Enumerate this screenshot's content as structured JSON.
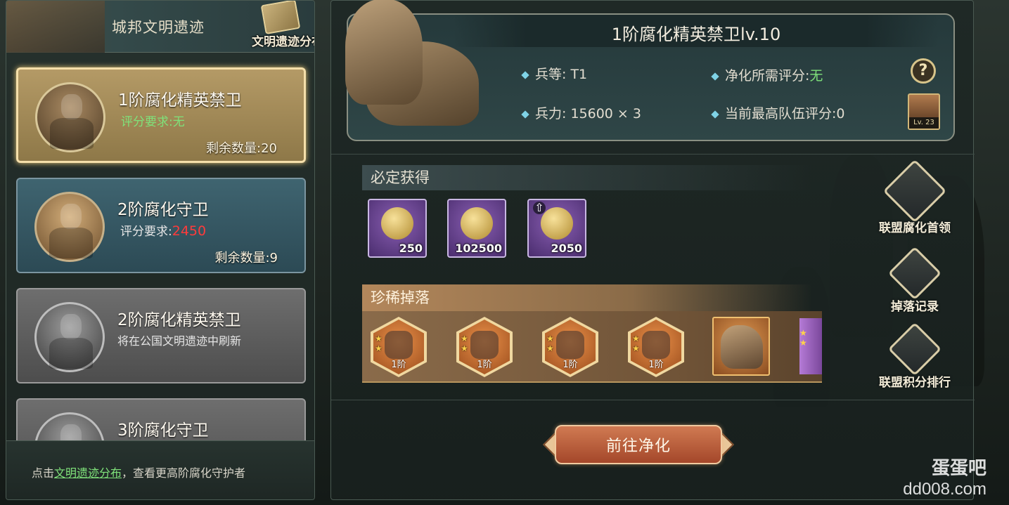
{
  "left": {
    "title": "城邦文明遗迹",
    "map_button_label": "文明遗迹分布",
    "cards": [
      {
        "name": "1阶腐化精英禁卫",
        "req_label": "评分要求:",
        "req_value": "无",
        "remaining": "剩余数量:20"
      },
      {
        "name": "2阶腐化守卫",
        "req_label": "评分要求:",
        "req_value": "2450",
        "remaining": "剩余数量:9"
      },
      {
        "name": "2阶腐化精英禁卫",
        "note": "将在公国文明遗迹中刷新"
      },
      {
        "name": "3阶腐化守卫"
      }
    ],
    "footer": {
      "prefix": "点击",
      "link": "文明遗迹分布",
      "suffix": "，查看更高阶腐化守护者"
    }
  },
  "detail": {
    "title": "1阶腐化精英禁卫lv.10",
    "troop_tier_label": "兵等:",
    "troop_tier_value": "T1",
    "purify_score_label": "净化所需评分:",
    "purify_score_value": "无",
    "troops_label": "兵力:",
    "troops_value": "15600 × 3",
    "best_team_label": "当前最高队伍评分:",
    "best_team_value": "0",
    "help_icon": "?",
    "avatar_level": "Lv. 23"
  },
  "rewards": {
    "guaranteed_title": "必定获得",
    "guaranteed": [
      {
        "icon": "medal-icon",
        "count": "250"
      },
      {
        "icon": "gold-coins-icon",
        "count": "102500"
      },
      {
        "icon": "gold-coins-upgrade-icon",
        "count": "2050"
      }
    ],
    "rare_title": "珍稀掉落",
    "rare": [
      {
        "icon": "shield-gear-icon",
        "tier": "1阶",
        "stars": 2
      },
      {
        "icon": "hero-portrait-icon",
        "tier": "1阶",
        "stars": 2
      },
      {
        "icon": "book-chest-icon",
        "tier": "1阶",
        "stars": 2
      },
      {
        "icon": "horn-icon",
        "tier": "1阶",
        "stars": 2
      }
    ]
  },
  "go_button_label": "前往净化",
  "side_buttons": [
    {
      "icon": "alliance-boss-icon",
      "label": "联盟腐化首领"
    },
    {
      "icon": "coins-drop-icon",
      "label": "掉落记录"
    },
    {
      "icon": "medal-rank-icon",
      "label": "联盟积分排行"
    }
  ],
  "watermark": {
    "top": "蛋蛋吧",
    "bottom": "dd008.com"
  },
  "colors": {
    "accent_green": "#7fe27a",
    "accent_red": "#ff3b3b",
    "gold_border": "#f5dfaa"
  }
}
